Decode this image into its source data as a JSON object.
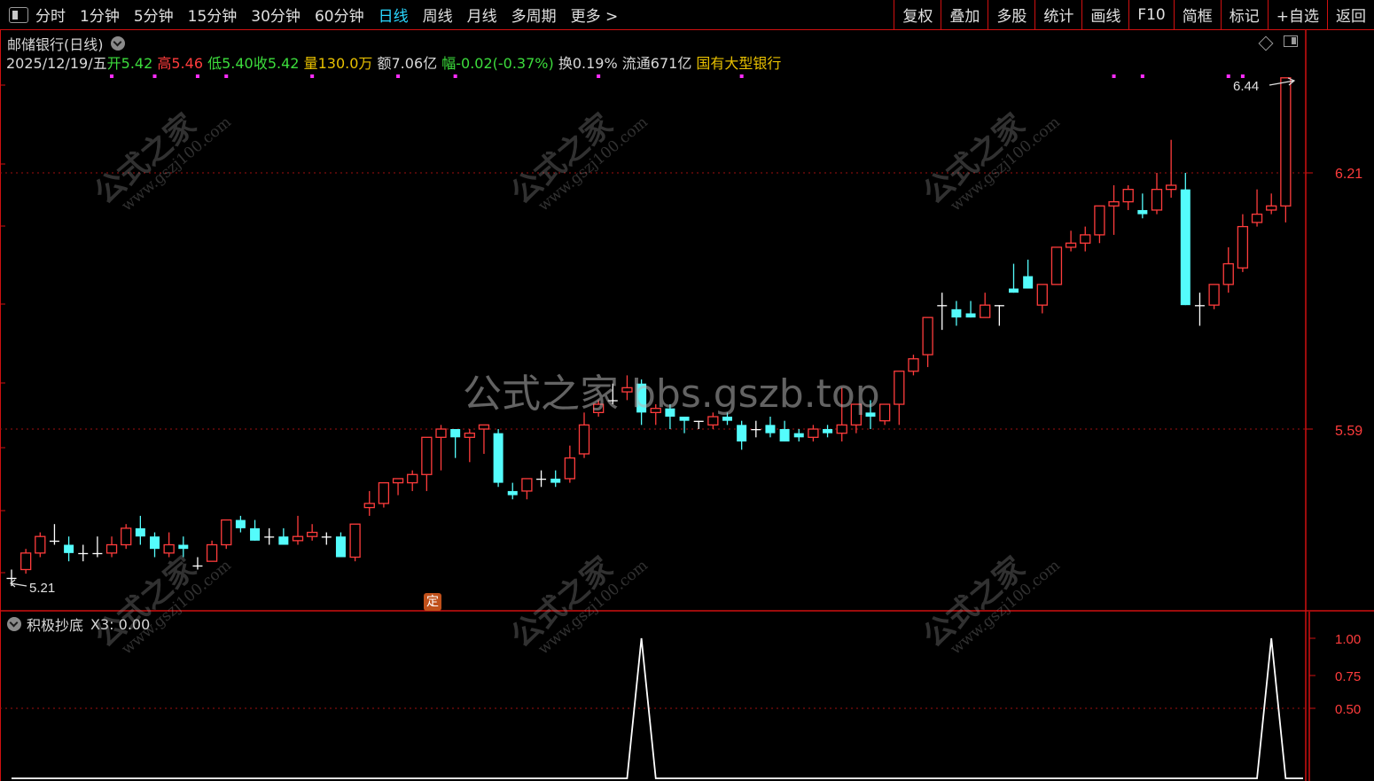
{
  "toolbar": {
    "periods": [
      {
        "label": "分时",
        "active": false
      },
      {
        "label": "1分钟",
        "active": false
      },
      {
        "label": "5分钟",
        "active": false
      },
      {
        "label": "15分钟",
        "active": false
      },
      {
        "label": "30分钟",
        "active": false
      },
      {
        "label": "60分钟",
        "active": false
      },
      {
        "label": "日线",
        "active": true
      },
      {
        "label": "周线",
        "active": false
      },
      {
        "label": "月线",
        "active": false
      },
      {
        "label": "多周期",
        "active": false
      },
      {
        "label": "更多 >",
        "active": false
      }
    ],
    "tools": [
      "复权",
      "叠加",
      "多股",
      "统计",
      "画线",
      "F10",
      "简框",
      "标记",
      "+自选",
      "返回"
    ]
  },
  "stock": {
    "title": "邮储银行(日线)",
    "date": "2025/12/19/五",
    "open_label": "开",
    "open": "5.42",
    "high_label": "高",
    "high": "5.46",
    "low_label": "低",
    "low": "5.40",
    "close_label": "收",
    "close": "5.42",
    "volume_label": "量",
    "volume": "130.0万",
    "amount_label": "额",
    "amount": "7.06亿",
    "change_label": "幅",
    "change": "-0.02(-0.37%)",
    "turnover_label": "换",
    "turnover": "0.19%",
    "float_label": "流通",
    "float": "671亿",
    "sector": "国有大型银行"
  },
  "price_axis": {
    "labels": [
      "6.21",
      "5.59"
    ],
    "max_marker": "6.44",
    "min_marker": "5.21"
  },
  "indicator": {
    "name": "积极抄底",
    "value_label": "X3: 0.00",
    "axis_labels": [
      "1.00",
      "0.75",
      "0.50"
    ]
  },
  "badge": "定",
  "watermarks": {
    "center": "公式之家 bbs.gszb.top",
    "tile_main": "公式之家",
    "tile_url": "www.gszj100.com"
  },
  "colors": {
    "up": "#ff3c3c",
    "down": "#54fcfc",
    "flat": "#ffffff",
    "grid": "#b01010",
    "axis_text": "#ff3c3c",
    "toolbar_active": "#2ad7ff"
  },
  "chart_data": {
    "type": "candlestick",
    "ohlc": [
      [
        5.23,
        5.25,
        5.21,
        5.23
      ],
      [
        5.25,
        5.3,
        5.24,
        5.29
      ],
      [
        5.29,
        5.34,
        5.28,
        5.33
      ],
      [
        5.32,
        5.36,
        5.31,
        5.32
      ],
      [
        5.31,
        5.33,
        5.27,
        5.29
      ],
      [
        5.29,
        5.31,
        5.27,
        5.29
      ],
      [
        5.29,
        5.33,
        5.28,
        5.29
      ],
      [
        5.29,
        5.33,
        5.28,
        5.31
      ],
      [
        5.31,
        5.36,
        5.3,
        5.35
      ],
      [
        5.35,
        5.38,
        5.31,
        5.33
      ],
      [
        5.33,
        5.34,
        5.28,
        5.3
      ],
      [
        5.29,
        5.34,
        5.28,
        5.31
      ],
      [
        5.31,
        5.33,
        5.28,
        5.3
      ],
      [
        5.26,
        5.28,
        5.25,
        5.26
      ],
      [
        5.27,
        5.32,
        5.27,
        5.31
      ],
      [
        5.31,
        5.37,
        5.3,
        5.37
      ],
      [
        5.37,
        5.38,
        5.34,
        5.35
      ],
      [
        5.35,
        5.37,
        5.33,
        5.32
      ],
      [
        5.33,
        5.35,
        5.31,
        5.33
      ],
      [
        5.33,
        5.35,
        5.31,
        5.31
      ],
      [
        5.32,
        5.38,
        5.31,
        5.33
      ],
      [
        5.33,
        5.36,
        5.32,
        5.34
      ],
      [
        5.33,
        5.34,
        5.31,
        5.33
      ],
      [
        5.33,
        5.34,
        5.28,
        5.28
      ],
      [
        5.28,
        5.36,
        5.27,
        5.36
      ],
      [
        5.4,
        5.44,
        5.38,
        5.41
      ],
      [
        5.41,
        5.46,
        5.4,
        5.46
      ],
      [
        5.46,
        5.47,
        5.43,
        5.47
      ],
      [
        5.46,
        5.49,
        5.44,
        5.48
      ],
      [
        5.48,
        5.55,
        5.44,
        5.57
      ],
      [
        5.57,
        5.6,
        5.49,
        5.59
      ],
      [
        5.59,
        5.58,
        5.52,
        5.57
      ],
      [
        5.57,
        5.59,
        5.51,
        5.58
      ],
      [
        5.59,
        5.6,
        5.53,
        5.6
      ],
      [
        5.58,
        5.59,
        5.45,
        5.46
      ],
      [
        5.44,
        5.46,
        5.42,
        5.43
      ],
      [
        5.44,
        5.47,
        5.42,
        5.47
      ],
      [
        5.47,
        5.49,
        5.45,
        5.47
      ],
      [
        5.47,
        5.49,
        5.45,
        5.46
      ],
      [
        5.47,
        5.55,
        5.46,
        5.52
      ],
      [
        5.53,
        5.63,
        5.52,
        5.6
      ],
      [
        5.63,
        5.66,
        5.62,
        5.65
      ],
      [
        5.66,
        5.7,
        5.65,
        5.66
      ],
      [
        5.68,
        5.72,
        5.66,
        5.69
      ],
      [
        5.7,
        5.71,
        5.6,
        5.63
      ],
      [
        5.63,
        5.65,
        5.6,
        5.64
      ],
      [
        5.64,
        5.65,
        5.59,
        5.62
      ],
      [
        5.62,
        5.62,
        5.58,
        5.61
      ],
      [
        5.61,
        5.61,
        5.59,
        5.61
      ],
      [
        5.6,
        5.63,
        5.59,
        5.62
      ],
      [
        5.62,
        5.63,
        5.6,
        5.61
      ],
      [
        5.6,
        5.61,
        5.54,
        5.56
      ],
      [
        5.59,
        5.61,
        5.57,
        5.59
      ],
      [
        5.6,
        5.62,
        5.57,
        5.58
      ],
      [
        5.59,
        5.61,
        5.58,
        5.56
      ],
      [
        5.58,
        5.59,
        5.56,
        5.57
      ],
      [
        5.57,
        5.6,
        5.56,
        5.59
      ],
      [
        5.59,
        5.6,
        5.57,
        5.58
      ],
      [
        5.58,
        5.69,
        5.56,
        5.6
      ],
      [
        5.6,
        5.64,
        5.58,
        5.65
      ],
      [
        5.63,
        5.66,
        5.59,
        5.62
      ],
      [
        5.61,
        5.64,
        5.6,
        5.65
      ],
      [
        5.65,
        5.71,
        5.6,
        5.73
      ],
      [
        5.73,
        5.77,
        5.72,
        5.76
      ],
      [
        5.77,
        5.82,
        5.74,
        5.86
      ],
      [
        5.89,
        5.92,
        5.83,
        5.89
      ],
      [
        5.88,
        5.9,
        5.84,
        5.86
      ],
      [
        5.87,
        5.9,
        5.86,
        5.86
      ],
      [
        5.86,
        5.92,
        5.86,
        5.89
      ],
      [
        5.89,
        5.89,
        5.84,
        5.89
      ],
      [
        5.93,
        5.99,
        5.96,
        5.92
      ],
      [
        5.96,
        6.0,
        5.93,
        5.93
      ],
      [
        5.89,
        5.94,
        5.87,
        5.94
      ],
      [
        5.94,
        6.01,
        5.94,
        6.03
      ],
      [
        6.03,
        6.07,
        6.02,
        6.04
      ],
      [
        6.04,
        6.08,
        6.02,
        6.06
      ],
      [
        6.06,
        6.08,
        6.04,
        6.13
      ],
      [
        6.13,
        6.18,
        6.06,
        6.14
      ],
      [
        6.14,
        6.18,
        6.12,
        6.17
      ],
      [
        6.12,
        6.16,
        6.1,
        6.11
      ],
      [
        6.12,
        6.21,
        6.11,
        6.17
      ],
      [
        6.17,
        6.29,
        6.15,
        6.18
      ],
      [
        6.17,
        6.21,
        6.03,
        5.89
      ],
      [
        5.89,
        5.92,
        5.84,
        5.89
      ],
      [
        5.89,
        5.94,
        5.88,
        5.94
      ],
      [
        5.94,
        6.03,
        5.92,
        5.99
      ],
      [
        5.98,
        6.11,
        5.97,
        6.08
      ],
      [
        6.09,
        6.17,
        6.08,
        6.11
      ],
      [
        6.12,
        6.16,
        6.11,
        6.13
      ],
      [
        6.13,
        6.43,
        6.09,
        6.44
      ]
    ],
    "indicator_peaks": [
      44,
      88
    ],
    "indicator_values": {
      "x": "bars",
      "peak": 1.0,
      "base": 0.0
    }
  }
}
